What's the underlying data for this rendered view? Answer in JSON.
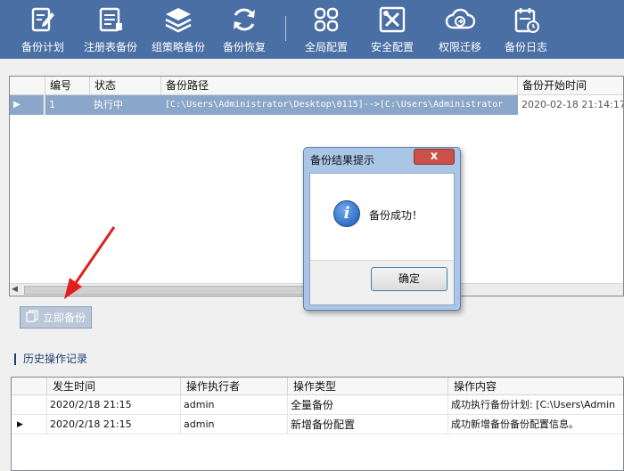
{
  "toolbar": {
    "items": [
      {
        "label": "备份计划",
        "icon": "edit-document-icon"
      },
      {
        "label": "注册表备份",
        "icon": "registry-document-icon"
      },
      {
        "label": "组策略备份",
        "icon": "layers-icon"
      },
      {
        "label": "备份恢复",
        "icon": "refresh-icon"
      },
      {
        "label": "全局配置",
        "icon": "grid-icon"
      },
      {
        "label": "安全配置",
        "icon": "tools-icon"
      },
      {
        "label": "权限迁移",
        "icon": "cloud-transfer-icon"
      },
      {
        "label": "备份日志",
        "icon": "calendar-log-icon"
      }
    ]
  },
  "main_grid": {
    "columns": [
      "编号",
      "状态",
      "备份路径",
      "备份开始时间"
    ],
    "rows": [
      {
        "id": "1",
        "status": "执行中",
        "path": "[C:\\Users\\Administrator\\Desktop\\0115]-->[C:\\Users\\Administrator",
        "start_time": "2020-02-18 21:14:17"
      }
    ]
  },
  "backup_button": {
    "label": "立即备份",
    "icon": "copy-icon"
  },
  "history": {
    "title": "历史操作记录",
    "columns": [
      "发生时间",
      "操作执行者",
      "操作类型",
      "操作内容"
    ],
    "rows": [
      {
        "time": "2020/2/18 21:15",
        "operator": "admin",
        "type": "全量备份",
        "content": "成功执行备份计划: [C:\\Users\\Admin"
      },
      {
        "time": "2020/2/18 21:15",
        "operator": "admin",
        "type": "新增备份配置",
        "content": "成功新增备份备份配置信息。"
      }
    ]
  },
  "dialog": {
    "title": "备份结果提示",
    "message": "备份成功！",
    "ok_label": "确定",
    "close_glyph": "x"
  },
  "colors": {
    "toolbar_bg": "#4a6fa5",
    "selected_row": "#8aa6c9",
    "annotation_arrow": "#e02020"
  }
}
